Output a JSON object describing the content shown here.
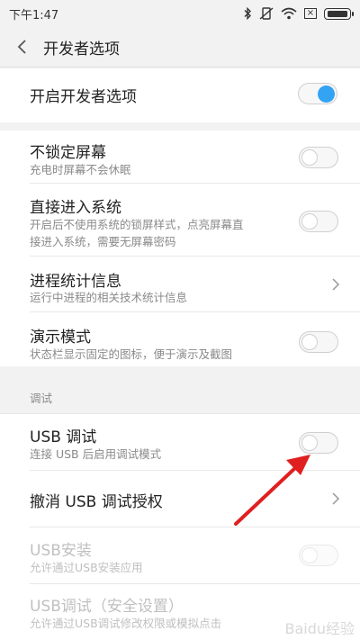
{
  "statusbar": {
    "time": "下午1:47",
    "x_box": "×"
  },
  "header": {
    "title": "开发者选项"
  },
  "dev_toggle": {
    "label": "开启开发者选项",
    "on": true
  },
  "items": [
    {
      "title": "不锁定屏幕",
      "subtitle": "充电时屏幕不会休眠"
    },
    {
      "title": "直接进入系统",
      "subtitle_line1": "开启后不使用系统的锁屏样式，点亮屏幕直",
      "subtitle_line2": "接进入系统，需要无屏幕密码"
    },
    {
      "title": "进程统计信息",
      "subtitle": "运行中进程的相关技术统计信息"
    },
    {
      "title": "演示模式",
      "subtitle": "状态栏显示固定的图标，便于演示及截图"
    }
  ],
  "debug_section": {
    "label": "调试",
    "usb_debug": {
      "title": "USB 调试",
      "subtitle": "连接 USB 后启用调试模式"
    },
    "revoke": {
      "title": "撤消 USB 调试授权"
    },
    "usb_install": {
      "title": "USB安装",
      "subtitle": "允许通过USB安装应用"
    },
    "usb_debug_secure": {
      "title": "USB调试（安全设置）",
      "subtitle": "允许通过USB调试修改权限或模拟点击"
    }
  },
  "watermark": "Baidu经验",
  "colors": {
    "accent": "#33a3f4",
    "annotation_arrow": "#e02020"
  }
}
